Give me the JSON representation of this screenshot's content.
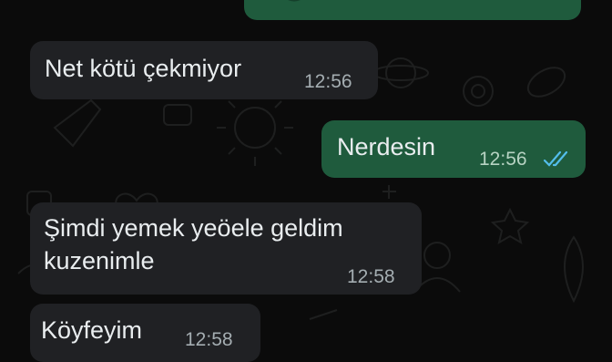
{
  "colors": {
    "background": "#0b0b0b",
    "incoming_bubble": "#202124",
    "outgoing_bubble": "#1f5b3d",
    "read_ticks": "#53bdeb"
  },
  "messages": [
    {
      "direction": "outgoing",
      "text": "",
      "time": "",
      "partial": true
    },
    {
      "direction": "incoming",
      "text": "Net kötü çekmiyor",
      "time": "12:56"
    },
    {
      "direction": "outgoing",
      "text": "Nerdesin",
      "time": "12:56",
      "status_icon": "double-check-read-icon"
    },
    {
      "direction": "incoming",
      "text": "Şimdi yemek yeöele geldim\nkuzenimle",
      "time": "12:58"
    },
    {
      "direction": "incoming",
      "text": "Köyfeyim",
      "time": "12:58"
    }
  ]
}
